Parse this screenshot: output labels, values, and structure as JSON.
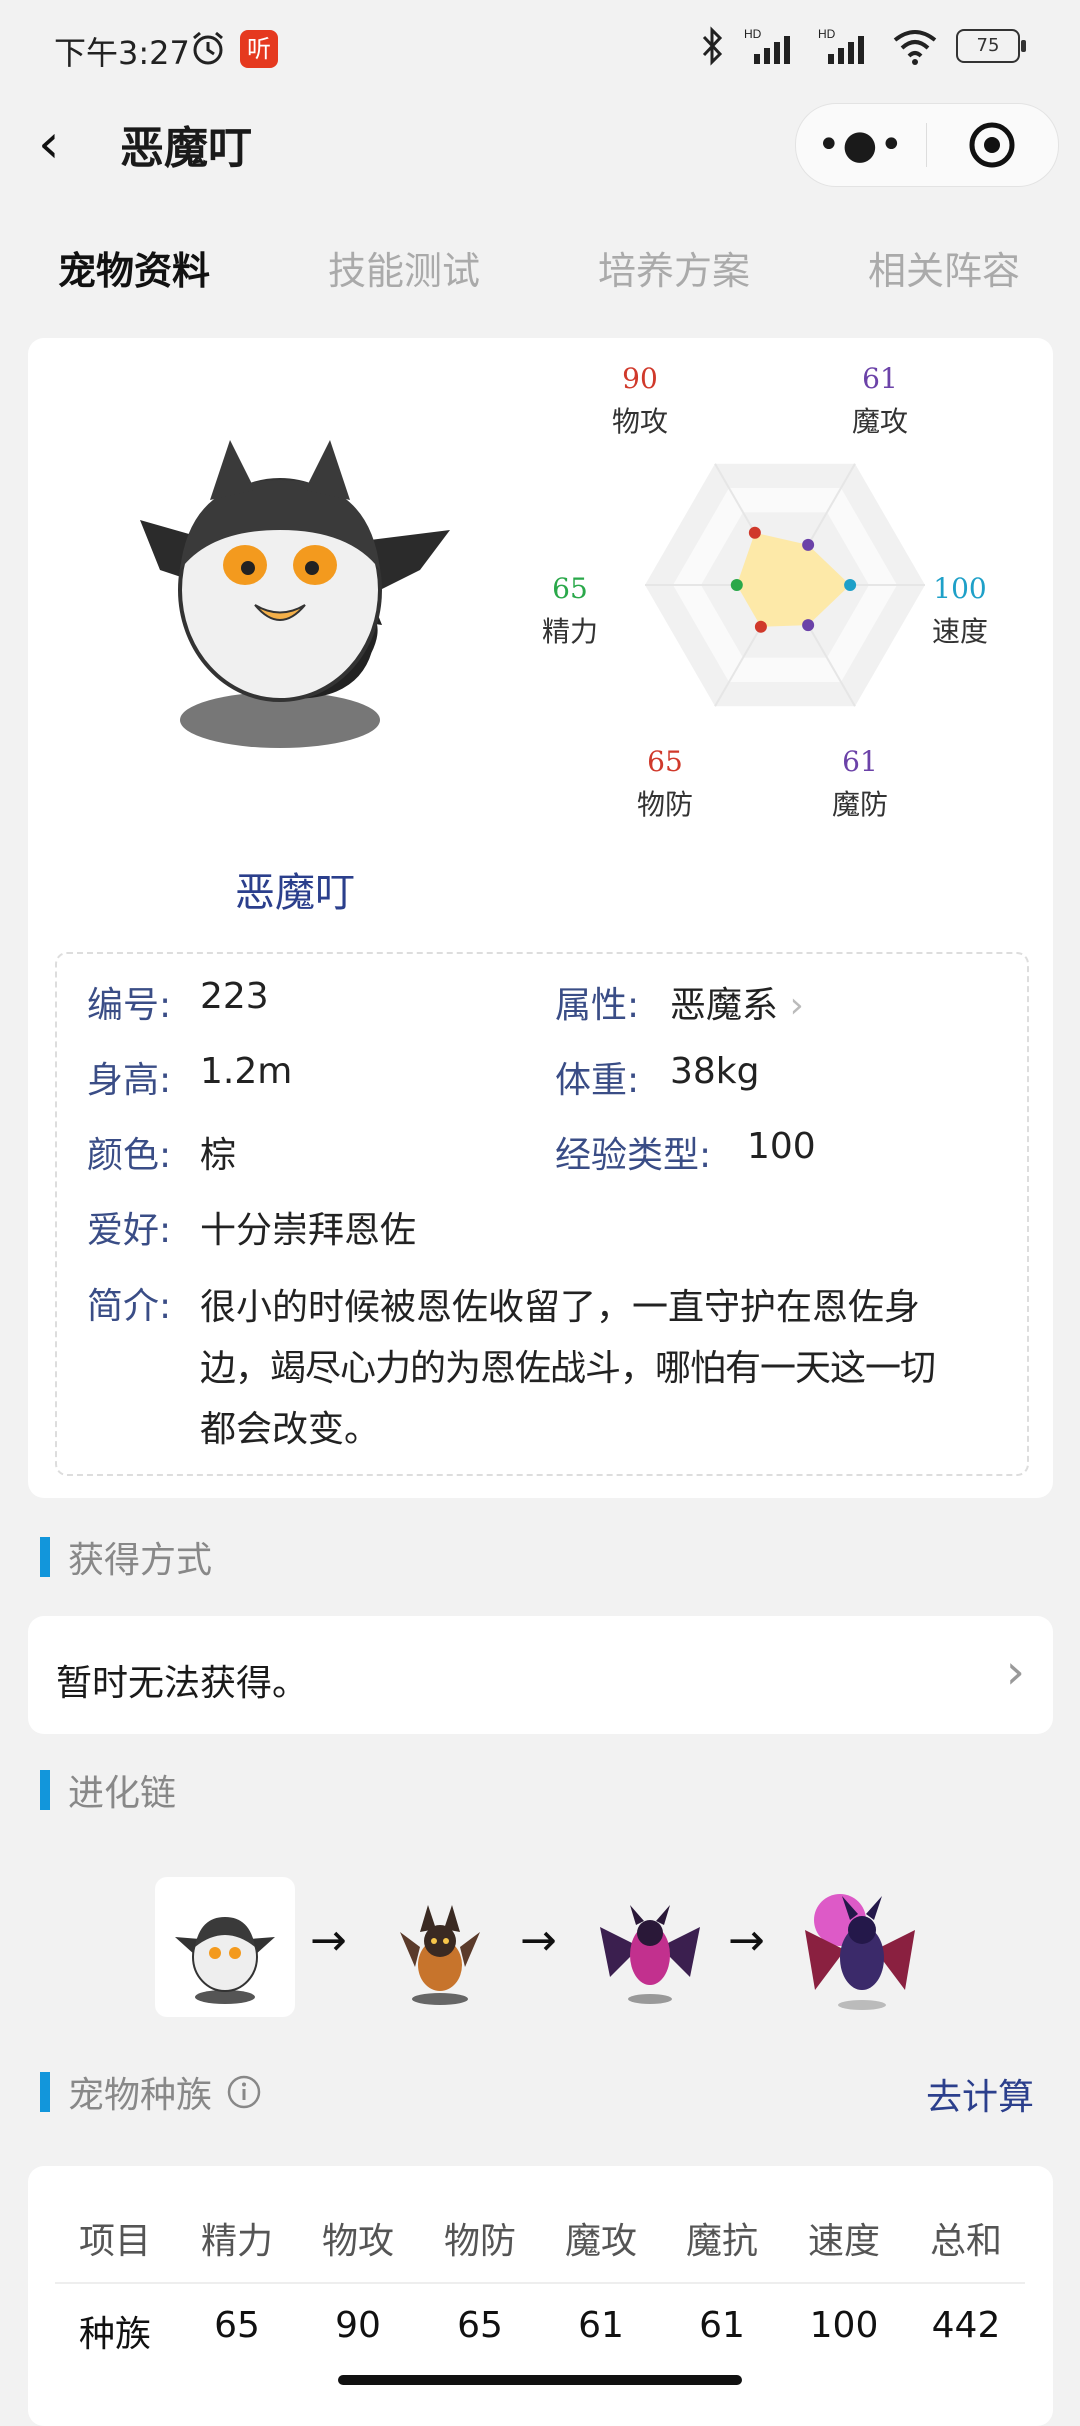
{
  "status": {
    "time": "下午3:27",
    "badge": "听",
    "battery": "75",
    "network": "HD"
  },
  "header": {
    "title": "恶魔叮"
  },
  "tabs": [
    "宠物资料",
    "技能测试",
    "培养方案",
    "相关阵容"
  ],
  "pet": {
    "name": "恶魔叮"
  },
  "chart_data": {
    "type": "radar",
    "axes": [
      {
        "label": "物攻",
        "value": 90,
        "color": "#d0392b"
      },
      {
        "label": "魔攻",
        "value": 61,
        "color": "#6b42a8"
      },
      {
        "label": "速度",
        "value": 100,
        "color": "#1ea0c8"
      },
      {
        "label": "魔防",
        "value": 61,
        "color": "#6b42a8"
      },
      {
        "label": "物防",
        "value": 65,
        "color": "#d0392b"
      },
      {
        "label": "精力",
        "value": 65,
        "color": "#2aa84a"
      }
    ],
    "fill_color": "#fde9a8"
  },
  "info": {
    "number_k": "编号:",
    "number_v": "223",
    "attr_k": "属性:",
    "attr_v": "恶魔系",
    "height_k": "身高:",
    "height_v": "1.2m",
    "weight_k": "体重:",
    "weight_v": "38kg",
    "color_k": "颜色:",
    "color_v": "棕",
    "exp_k": "经验类型:",
    "exp_v": "100",
    "hobby_k": "爱好:",
    "hobby_v": "十分崇拜恩佐",
    "desc_k": "简介:",
    "desc_lines": [
      "很小的时候被恩佐收留了，一直守护在恩佐身",
      "边，竭尽心力的为恩佐战斗，哪怕有一天这一切",
      "都会改变。"
    ]
  },
  "obtain": {
    "title": "获得方式",
    "text": "暂时无法获得。"
  },
  "evolution": {
    "title": "进化链",
    "arrow": "→"
  },
  "race": {
    "title": "宠物种族",
    "calc": "去计算",
    "headers": [
      "项目",
      "精力",
      "物攻",
      "物防",
      "魔攻",
      "魔抗",
      "速度",
      "总和"
    ],
    "row": [
      "种族",
      "65",
      "90",
      "65",
      "61",
      "61",
      "100",
      "442"
    ]
  }
}
